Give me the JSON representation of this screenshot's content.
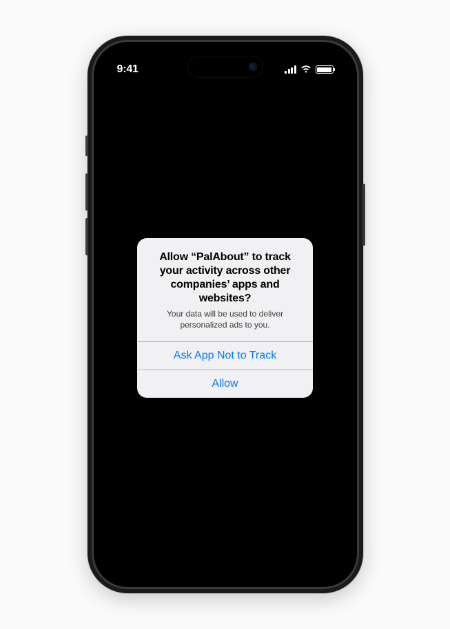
{
  "status_bar": {
    "time": "9:41"
  },
  "alert": {
    "title": "Allow “PalAbout” to track your activity across other companies’ apps and websites?",
    "message": "Your data will be used to deliver personalized ads to you.",
    "primary_action": "Ask App Not to Track",
    "secondary_action": "Allow"
  }
}
